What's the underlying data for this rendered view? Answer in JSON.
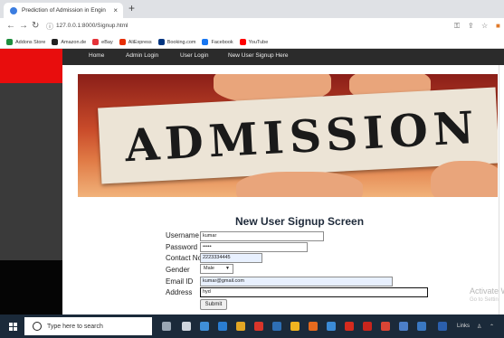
{
  "browser": {
    "tab_title": "Prediction of Admission in Engin",
    "tab_close": "×",
    "new_tab": "+",
    "url": "127.0.0.1:8000/Signup.html",
    "bookmarks": [
      {
        "label": "Addons Store",
        "color": "#1e8e3e"
      },
      {
        "label": "Amazon.de",
        "color": "#222222"
      },
      {
        "label": "eBay",
        "color": "#e53238"
      },
      {
        "label": "AliExpress",
        "color": "#e62e04"
      },
      {
        "label": "Booking.com",
        "color": "#003580"
      },
      {
        "label": "Facebook",
        "color": "#1877f2"
      },
      {
        "label": "YouTube",
        "color": "#ff0000"
      }
    ]
  },
  "nav": {
    "home": "Home",
    "admin_login": "Admin Login",
    "user_login": "User Login",
    "signup": "New User Signup Here"
  },
  "banner": {
    "text": "ADMISSION"
  },
  "form": {
    "title": "New User Signup Screen",
    "username_label": "Username",
    "username_value": "kumar",
    "password_label": "Password",
    "password_value": "•••••",
    "contact_label": "Contact No",
    "contact_value": "2223334445",
    "gender_label": "Gender",
    "gender_value": "Male",
    "email_label": "Email ID",
    "email_value": "kumar@gmail.com",
    "address_label": "Address",
    "address_value": "hyd",
    "submit_label": "Submit"
  },
  "watermark": {
    "line1": "Activate W",
    "line2": "Go to Settin"
  },
  "taskbar": {
    "search_placeholder": "Type here to search",
    "links_label": "Links"
  },
  "colors": {
    "sidebar_red": "#e80d0d",
    "navbar": "#2b2b2b",
    "taskbar": "#1b2a3a"
  }
}
